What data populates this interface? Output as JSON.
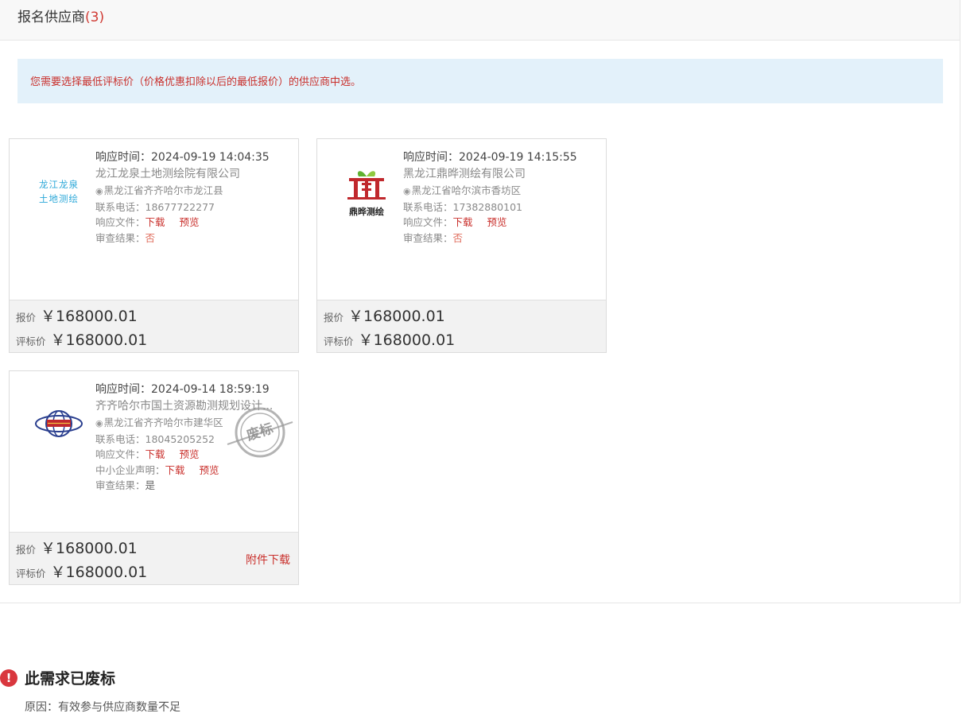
{
  "header": {
    "title": "报名供应商",
    "count": "(3)"
  },
  "notice": "您需要选择最低评标价（价格优惠扣除以后的最低报价）的供应商中选。",
  "labels": {
    "response_time": "响应时间：",
    "phone": "联系电话：",
    "file": "响应文件：",
    "sme": "中小企业声明：",
    "review": "审查结果：",
    "download": "下载",
    "preview": "预览",
    "quote": "报价",
    "eval_price": "评标价",
    "attachment_download": "附件下载"
  },
  "suppliers": [
    {
      "time": "2024-09-19 14:04:35",
      "name": "龙江龙泉土地测绘院有限公司",
      "address": "黑龙江省齐齐哈尔市龙江县",
      "phone": "18677722277",
      "review_result": "否",
      "quote": "￥168000.01",
      "eval_price": "￥168000.01",
      "logo_line1": "龙江龙泉",
      "logo_line2": "土地测绘"
    },
    {
      "time": "2024-09-19 14:15:55",
      "name": "黑龙江鼎晔测绘有限公司",
      "address": "黑龙江省哈尔滨市香坊区",
      "phone": "17382880101",
      "review_result": "否",
      "quote": "￥168000.01",
      "eval_price": "￥168000.01",
      "logo_text": "鼎晔测绘"
    },
    {
      "time": "2024-09-14 18:59:19",
      "name": "齐齐哈尔市国土资源勘测规划设计...",
      "address": "黑龙江省齐齐哈尔市建华区",
      "phone": "18045205252",
      "review_result": "是",
      "quote": "￥168000.01",
      "eval_price": "￥168000.01",
      "stamp_text": "废标"
    }
  ],
  "status": {
    "icon": "!",
    "title": "此需求已废标",
    "reason": "原因：有效参与供应商数量不足"
  },
  "colors": {
    "accent_red": "#c9302c",
    "notice_bg": "#e3f1fa",
    "status_red": "#d9373e"
  }
}
